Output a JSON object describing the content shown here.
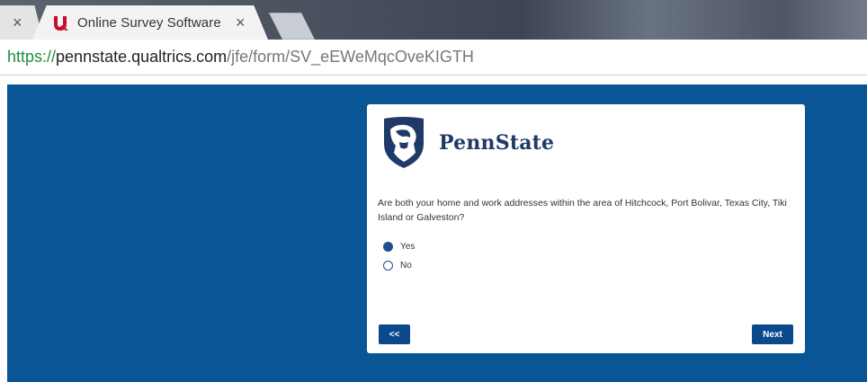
{
  "browser": {
    "prev_tab": {
      "close_glyph": "×"
    },
    "active_tab": {
      "favicon": "qualtrics-logo-icon",
      "favicon_color": "#c8102e",
      "title": "Online Survey Software | Qualtrics",
      "close_glyph": "×"
    },
    "new_tab": {
      "icon": "new-tab-icon"
    },
    "address": {
      "scheme": "https://",
      "host": "pennstate.qualtrics.com",
      "path": "/jfe/form/SV_eEWeMqcOveKIGTH"
    }
  },
  "survey": {
    "background_color": "#0a5595",
    "logo": {
      "icon": "nittany-lion-shield-icon",
      "text": "PennState",
      "color": "#1f3a68"
    },
    "question": "Are both your home and work addresses within the area of Hitchcock, Port Bolivar, Texas City, Tiki Island or Galveston?",
    "choices": [
      {
        "label": "Yes",
        "selected": true
      },
      {
        "label": "No",
        "selected": false
      }
    ],
    "back_button": "<<",
    "next_button": "Next",
    "button_color": "#0a4a8c"
  }
}
